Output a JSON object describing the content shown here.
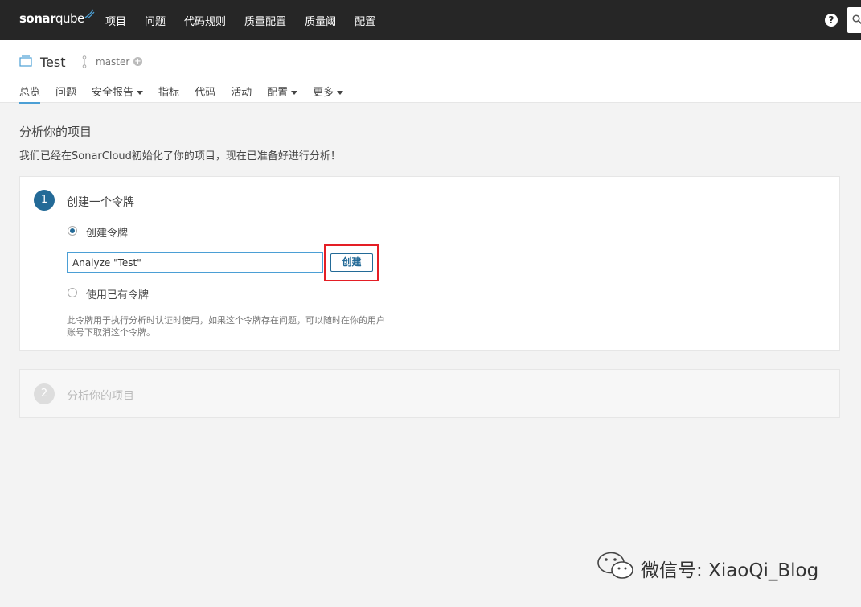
{
  "topbar": {
    "logo_bold": "sonar",
    "logo_light": "qube",
    "nav": [
      "项目",
      "问题",
      "代码规则",
      "质量配置",
      "质量阈",
      "配置"
    ],
    "help_label": "?",
    "background": "#262626"
  },
  "project": {
    "name": "Test",
    "branch": "master",
    "add_branch": "+"
  },
  "tabs": [
    {
      "label": "总览",
      "active": true
    },
    {
      "label": "问题"
    },
    {
      "label": "安全报告",
      "dropdown": true
    },
    {
      "label": "指标"
    },
    {
      "label": "代码"
    },
    {
      "label": "活动"
    },
    {
      "label": "配置",
      "dropdown": true
    },
    {
      "label": "更多",
      "dropdown": true
    }
  ],
  "main": {
    "title": "分析你的项目",
    "description": "我们已经在SonarCloud初始化了你的项目，现在已准备好进行分析！"
  },
  "step1": {
    "number": "1",
    "title": "创建一个令牌",
    "option_create": "创建令牌",
    "token_value": "Analyze \"Test\"",
    "create_button": "创建",
    "option_existing": "使用已有令牌",
    "hint_line1": "此令牌用于执行分析时认证时使用，如果这个令牌存在问题，可以随时在你的用户",
    "hint_line2": "账号下取消这个令牌。"
  },
  "step2": {
    "number": "2",
    "title": "分析你的项目"
  },
  "watermark": {
    "text": "微信号: XiaoQi_Blog"
  },
  "colors": {
    "accent": "#236a97",
    "link": "#4b9fd5",
    "highlight": "#e41e25"
  }
}
